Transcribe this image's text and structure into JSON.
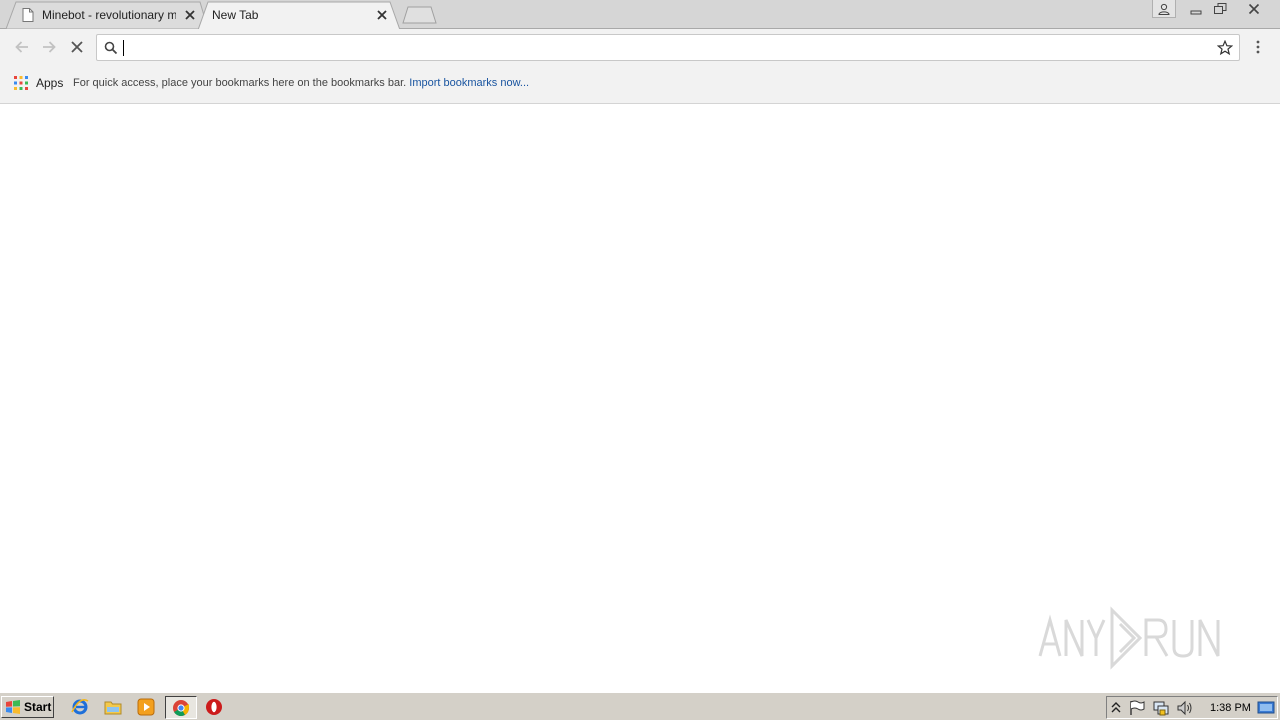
{
  "browser": {
    "tabs": [
      {
        "title": "Minebot - revolutionary mine",
        "active": false,
        "icon": "document-icon"
      },
      {
        "title": "New Tab",
        "active": true
      }
    ],
    "omnibox": {
      "value": "",
      "placeholder": ""
    },
    "bookmarks_bar": {
      "apps_label": "Apps",
      "hint_text": "For quick access, place your bookmarks here on the bookmarks bar.",
      "import_link": "Import bookmarks now..."
    }
  },
  "taskbar": {
    "start_label": "Start",
    "clock": "1:38 PM",
    "pinned": [
      "internet-explorer-icon",
      "folder-icon",
      "media-player-icon",
      "chrome-icon",
      "opera-icon"
    ]
  },
  "watermark": {
    "text": "ANY RUN"
  },
  "colors": {
    "link": "#1a55a0",
    "tabstrip": "#d6d6d6",
    "toolbar": "#f2f2f2",
    "taskbar": "#d4d0c8"
  }
}
